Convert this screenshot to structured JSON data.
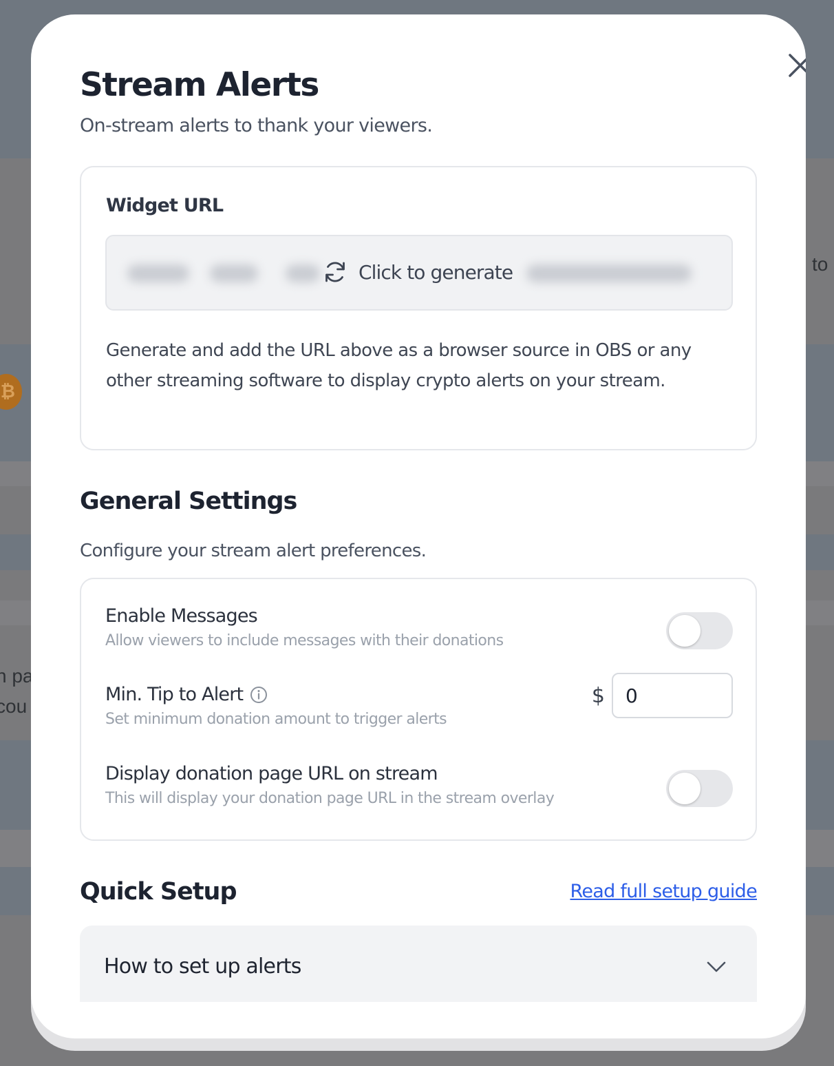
{
  "background": {
    "fragment_right": "to",
    "fragment_left_1": "n pa",
    "fragment_left_2": "cou",
    "coin_icon": "bitcoin-icon"
  },
  "modal": {
    "title": "Stream Alerts",
    "subtitle": "On-stream alerts to thank your viewers.",
    "close_icon": "close-icon"
  },
  "widget": {
    "label": "Widget URL",
    "generate_label": "Click to generate",
    "generate_icon": "refresh-icon",
    "description": "Generate and add the URL above as a browser source in OBS or any other streaming software to display crypto alerts on your stream."
  },
  "general_settings": {
    "title": "General Settings",
    "subtitle": "Configure your stream alert preferences.",
    "enable_messages": {
      "label": "Enable Messages",
      "help": "Allow viewers to include messages with their donations",
      "enabled": false
    },
    "min_tip": {
      "label": "Min. Tip to Alert",
      "help": "Set minimum donation amount to trigger alerts",
      "currency": "$",
      "value": "0",
      "info_icon": "info-icon"
    },
    "display_url": {
      "label": "Display donation page URL on stream",
      "help": "This will display your donation page URL in the stream overlay",
      "enabled": false
    }
  },
  "quick_setup": {
    "title": "Quick Setup",
    "guide_link": "Read full setup guide",
    "accordion_label": "How to set up alerts",
    "accordion_icon": "chevron-down-icon"
  },
  "colors": {
    "link": "#2d5ee8",
    "toggle_off": "#e6e7ea",
    "overlay": "#6e7278"
  }
}
